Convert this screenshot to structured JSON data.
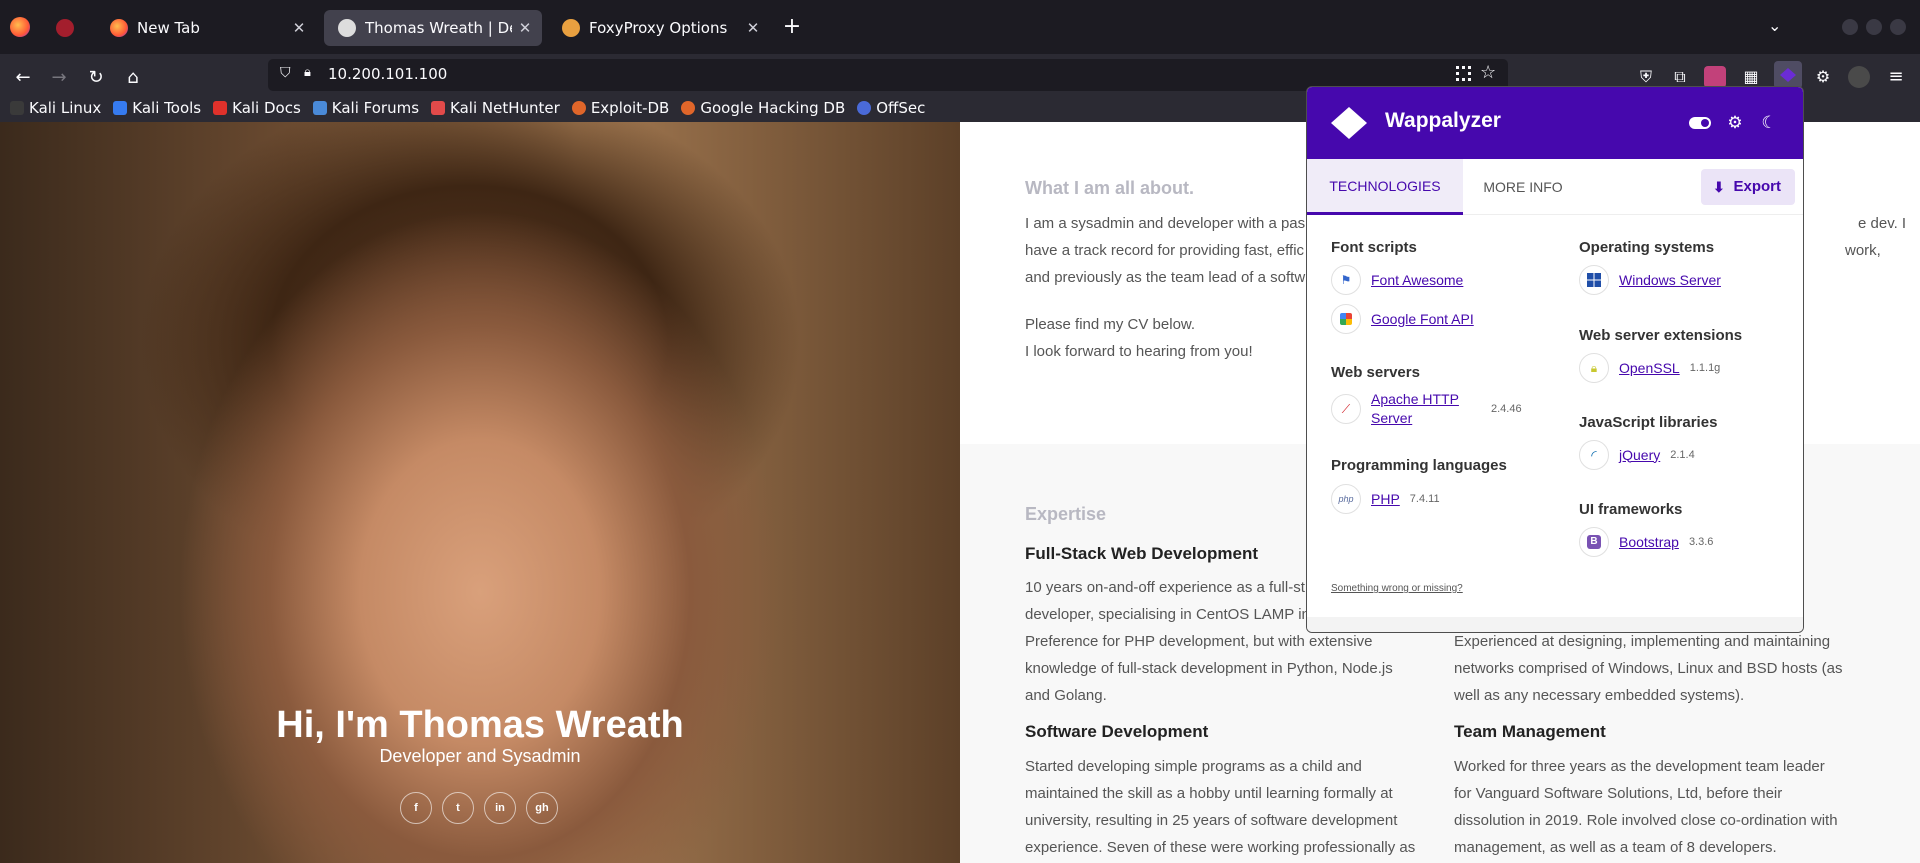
{
  "tabs": [
    {
      "label": "",
      "icon": "shield-icon"
    },
    {
      "label": "New Tab",
      "icon": "firefox-icon"
    },
    {
      "label": "Thomas Wreath | Develop",
      "icon": "site-favicon",
      "active": true
    },
    {
      "label": "FoxyProxy Options",
      "icon": "foxyproxy-icon"
    }
  ],
  "address": {
    "url": "10.200.101.100"
  },
  "bookmarks": [
    "Kali Linux",
    "Kali Tools",
    "Kali Docs",
    "Kali Forums",
    "Kali NetHunter",
    "Exploit-DB",
    "Google Hacking DB",
    "OffSec"
  ],
  "hero": {
    "name": "Hi, I'm Thomas Wreath",
    "role": "Developer and Sysadmin",
    "social": [
      "f",
      "t",
      "in",
      "gh"
    ]
  },
  "content": {
    "about_title": "What I am all about.",
    "about_lines": [
      "I am a sysadmin and developer with a pas",
      "have a track record for providing fast, effic",
      "and previously as the team lead of a softw"
    ],
    "about_right": [
      "e dev. I",
      "work,"
    ],
    "cv_lines": [
      "Please find my CV below.",
      "I look forward to hearing from you!"
    ],
    "expertise_title": "Expertise",
    "fullstack": {
      "title": "Full-Stack Web Development",
      "lines": [
        "10 years on-and-off experience as a full-st",
        "developer, specialising in CentOS LAMP in",
        "Preference for PHP development, but with extensive",
        "knowledge of full-stack development in Python, Node.js",
        "and Golang."
      ]
    },
    "network": {
      "lines": [
        "Experienced at designing, implementing and maintaining",
        "networks comprised of Windows, Linux and BSD hosts (as",
        "well as any necessary embedded systems)."
      ]
    },
    "software": {
      "title": "Software Development",
      "lines": [
        "Started developing simple programs as a child and",
        "maintained the skill as a hobby until learning formally at",
        "university, resulting in 25 years of software development",
        "experience. Seven of these were working professionally as"
      ]
    },
    "team": {
      "title": "Team Management",
      "lines": [
        "Worked for three years as the development team leader",
        "for Vanguard Software Solutions, Ltd, before their",
        "dissolution in 2019. Role involved close co-ordination with",
        "management, as well as a team of 8 developers."
      ]
    }
  },
  "wappalyzer": {
    "brand": "Wappalyzer",
    "tab_technologies": "TECHNOLOGIES",
    "tab_more": "MORE INFO",
    "export": "Export",
    "left": [
      {
        "category": "Font scripts",
        "items": [
          {
            "name": "Font Awesome",
            "version": ""
          },
          {
            "name": "Google Font API",
            "version": ""
          }
        ]
      },
      {
        "category": "Web servers",
        "items": [
          {
            "name": "Apache HTTP Server",
            "version": "2.4.46"
          }
        ]
      },
      {
        "category": "Programming languages",
        "items": [
          {
            "name": "PHP",
            "version": "7.4.11"
          }
        ]
      }
    ],
    "right": [
      {
        "category": "Operating systems",
        "items": [
          {
            "name": "Windows Server",
            "version": ""
          }
        ]
      },
      {
        "category": "Web server extensions",
        "items": [
          {
            "name": "OpenSSL",
            "version": "1.1.1g"
          }
        ]
      },
      {
        "category": "JavaScript libraries",
        "items": [
          {
            "name": "jQuery",
            "version": "2.1.4"
          }
        ]
      },
      {
        "category": "UI frameworks",
        "items": [
          {
            "name": "Bootstrap",
            "version": "3.3.6"
          }
        ]
      }
    ],
    "footer_link": "Something wrong or missing?"
  }
}
